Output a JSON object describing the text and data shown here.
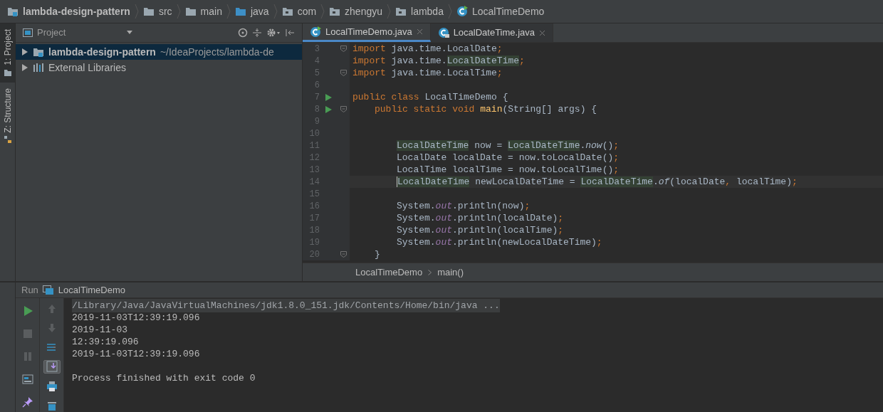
{
  "breadcrumb": [
    {
      "kind": "module",
      "label": "lambda-design-pattern"
    },
    {
      "kind": "folder",
      "label": "src"
    },
    {
      "kind": "folder",
      "label": "main"
    },
    {
      "kind": "source_folder",
      "label": "java"
    },
    {
      "kind": "package",
      "label": "com"
    },
    {
      "kind": "package",
      "label": "zhengyu"
    },
    {
      "kind": "package",
      "label": "lambda"
    },
    {
      "kind": "class",
      "label": "LocalTimeDemo"
    }
  ],
  "tool_tabs": [
    {
      "label": "1: Project",
      "selected": true
    },
    {
      "label": "Z: Structure",
      "selected": false
    }
  ],
  "project_panel": {
    "title": "Project",
    "tree": [
      {
        "kind": "module",
        "label": "lambda-design-pattern",
        "path": "~/IdeaProjects/lambda-de",
        "expanded": false,
        "selected": true
      },
      {
        "kind": "libraries",
        "label": "External Libraries",
        "expanded": false,
        "selected": false
      }
    ]
  },
  "editor_tabs": [
    {
      "label": "LocalTimeDemo.java",
      "selected": true,
      "locked": false
    },
    {
      "label": "LocalDateTime.java",
      "selected": false,
      "locked": true
    }
  ],
  "code_lines": [
    {
      "number": "3",
      "kind": "top",
      "run": false,
      "fold": true,
      "current": false,
      "tokens": [
        {
          "kind": "kw",
          "text": "import"
        },
        {
          "kind": "plain",
          "text": " java.time.LocalDate"
        },
        {
          "kind": "punct",
          "text": ";"
        }
      ]
    },
    {
      "number": "4",
      "kind": "top",
      "run": false,
      "fold": false,
      "current": false,
      "tokens": [
        {
          "kind": "kw",
          "text": "import"
        },
        {
          "kind": "plain",
          "text": " java.time."
        },
        {
          "kind": "usage",
          "text": "LocalDateTime"
        },
        {
          "kind": "punct",
          "text": ";"
        }
      ]
    },
    {
      "number": "5",
      "kind": "top",
      "run": false,
      "fold": true,
      "current": false,
      "tokens": [
        {
          "kind": "kw",
          "text": "import"
        },
        {
          "kind": "plain",
          "text": " java.time.LocalTime"
        },
        {
          "kind": "punct",
          "text": ";"
        }
      ]
    },
    {
      "number": "6",
      "kind": "top",
      "run": false,
      "fold": false,
      "current": false
    },
    {
      "number": "7",
      "kind": "top",
      "run": true,
      "fold": false,
      "current": false,
      "tokens": [
        {
          "kind": "kw",
          "text": "public class"
        },
        {
          "kind": "plain",
          "text": " LocalTimeDemo {"
        }
      ]
    },
    {
      "number": "8",
      "kind": "member",
      "run": true,
      "fold": true,
      "current": false,
      "tokens": [
        {
          "kind": "kw",
          "text": "public static void "
        },
        {
          "kind": "decl",
          "text": "main"
        },
        {
          "kind": "plain",
          "text": "(String[] args) {"
        }
      ]
    },
    {
      "number": "9",
      "kind": "body",
      "run": false,
      "fold": false,
      "current": false
    },
    {
      "number": "10",
      "kind": "body",
      "run": false,
      "fold": false,
      "current": false
    },
    {
      "number": "11",
      "kind": "body",
      "run": false,
      "fold": false,
      "current": false,
      "tokens": [
        {
          "kind": "usage",
          "text": "LocalDateTime"
        },
        {
          "kind": "plain",
          "text": " now = "
        },
        {
          "kind": "usage",
          "text": "LocalDateTime"
        },
        {
          "kind": "plain",
          "text": "."
        },
        {
          "kind": "italic",
          "text": "now"
        },
        {
          "kind": "plain",
          "text": "()"
        },
        {
          "kind": "punct",
          "text": ";"
        }
      ]
    },
    {
      "number": "12",
      "kind": "body",
      "run": false,
      "fold": false,
      "current": false,
      "tokens": [
        {
          "kind": "plain",
          "text": "LocalDate localDate = now.toLocalDate()"
        },
        {
          "kind": "punct",
          "text": ";"
        }
      ]
    },
    {
      "number": "13",
      "kind": "body",
      "run": false,
      "fold": false,
      "current": false,
      "tokens": [
        {
          "kind": "plain",
          "text": "LocalTime localTime = now.toLocalTime()"
        },
        {
          "kind": "punct",
          "text": ";"
        }
      ]
    },
    {
      "number": "14",
      "kind": "body",
      "run": false,
      "fold": false,
      "current": true,
      "tokens": [
        {
          "kind": "usage",
          "text": "LocalDateTime"
        },
        {
          "kind": "plain",
          "text": " newLocalDateTime = "
        },
        {
          "kind": "usage",
          "text": "LocalDateTime"
        },
        {
          "kind": "plain",
          "text": "."
        },
        {
          "kind": "italic",
          "text": "of"
        },
        {
          "kind": "plain",
          "text": "(localDate"
        },
        {
          "kind": "punct",
          "text": ","
        },
        {
          "kind": "plain",
          "text": " localTime)"
        },
        {
          "kind": "punct",
          "text": ";"
        }
      ]
    },
    {
      "number": "15",
      "kind": "body",
      "run": false,
      "fold": false,
      "current": false
    },
    {
      "number": "16",
      "kind": "body",
      "run": false,
      "fold": false,
      "current": false,
      "tokens": [
        {
          "kind": "plain",
          "text": "System."
        },
        {
          "kind": "static",
          "text": "out"
        },
        {
          "kind": "plain",
          "text": ".println(now)"
        },
        {
          "kind": "punct",
          "text": ";"
        }
      ]
    },
    {
      "number": "17",
      "kind": "body",
      "run": false,
      "fold": false,
      "current": false,
      "tokens": [
        {
          "kind": "plain",
          "text": "System."
        },
        {
          "kind": "static",
          "text": "out"
        },
        {
          "kind": "plain",
          "text": ".println(localDate)"
        },
        {
          "kind": "punct",
          "text": ";"
        }
      ]
    },
    {
      "number": "18",
      "kind": "body",
      "run": false,
      "fold": false,
      "current": false,
      "tokens": [
        {
          "kind": "plain",
          "text": "System."
        },
        {
          "kind": "static",
          "text": "out"
        },
        {
          "kind": "plain",
          "text": ".println(localTime)"
        },
        {
          "kind": "punct",
          "text": ";"
        }
      ]
    },
    {
      "number": "19",
      "kind": "body",
      "run": false,
      "fold": false,
      "current": false,
      "tokens": [
        {
          "kind": "plain",
          "text": "System."
        },
        {
          "kind": "static",
          "text": "out"
        },
        {
          "kind": "plain",
          "text": ".println(newLocalDateTime)"
        },
        {
          "kind": "punct",
          "text": ";"
        }
      ]
    },
    {
      "number": "20",
      "kind": "member",
      "run": false,
      "fold": true,
      "current": false,
      "tokens": [
        {
          "kind": "plain",
          "text": "}"
        }
      ]
    }
  ],
  "editor_breadcrumb": [
    "LocalTimeDemo",
    "main()"
  ],
  "run_panel": {
    "title": "Run",
    "config": "LocalTimeDemo",
    "tools_left": [
      {
        "kind": "run",
        "on": false
      },
      {
        "kind": "stop",
        "on": false
      },
      {
        "kind": "pause",
        "on": false
      },
      {
        "kind": "layout",
        "on": false
      },
      {
        "kind": "pin",
        "on": false
      }
    ],
    "tools_right": [
      {
        "kind": "up",
        "on": false
      },
      {
        "kind": "down",
        "on": false
      },
      {
        "kind": "wrap",
        "on": false
      },
      {
        "kind": "scroll_end",
        "on": true
      },
      {
        "kind": "print",
        "on": false
      },
      {
        "kind": "trash",
        "on": false
      }
    ],
    "output": [
      {
        "kind": "command",
        "text": "/Library/Java/JavaVirtualMachines/jdk1.8.0_151.jdk/Contents/Home/bin/java ..."
      },
      {
        "kind": "stdout",
        "text": "2019-11-03T12:39:19.096"
      },
      {
        "kind": "stdout",
        "text": "2019-11-03"
      },
      {
        "kind": "stdout",
        "text": "12:39:19.096"
      },
      {
        "kind": "stdout",
        "text": "2019-11-03T12:39:19.096"
      },
      {
        "kind": "blank"
      },
      {
        "kind": "stdout",
        "text": "Process finished with exit code 0"
      }
    ]
  }
}
